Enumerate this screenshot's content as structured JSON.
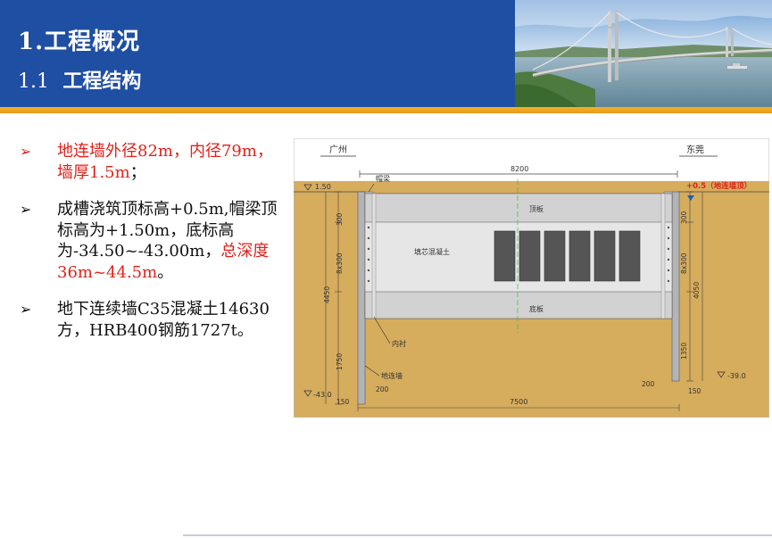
{
  "header": {
    "title_num": "1.",
    "title_text": "工程概况",
    "subtitle_num": "1.1",
    "subtitle_text": "工程结构"
  },
  "colors": {
    "header_bg": "#1f4fa3",
    "accent_bar": "#f4b02a",
    "highlight_red": "#e0221b"
  },
  "bullets": [
    {
      "icon": "arrow-bullet-icon",
      "arrow": "➢",
      "segments": [
        {
          "text": "地连墙外径82m，内径79m，墙厚1.5m",
          "color": "red"
        },
        {
          "text": "；",
          "color": "dark"
        }
      ]
    },
    {
      "icon": "arrow-bullet-icon",
      "arrow": "➢",
      "segments": [
        {
          "text": "成槽浇筑顶标高+0.5m,帽梁顶标高为+1.50m，底标高为-34.50~-43.00m，",
          "color": "dark"
        },
        {
          "text": "总深度36m~44.5m",
          "color": "red"
        },
        {
          "text": "。",
          "color": "dark"
        }
      ]
    },
    {
      "icon": "arrow-bullet-icon",
      "arrow": "➢",
      "segments": [
        {
          "text": "地下连续墙C35混凝土14630方，HRB400钢筋1727t。",
          "color": "dark"
        }
      ]
    }
  ],
  "diagram": {
    "left_label": "广州",
    "right_label": "东莞",
    "labels": {
      "cap_beam": "帽梁",
      "top_slab": "顶板",
      "core_fill": "填芯混凝土",
      "bottom_slab": "底板",
      "inner_lining": "内衬",
      "diaphragm_wall": "地连墙",
      "wall_top_note": "+0.5（地连墙顶）"
    },
    "elevations": {
      "left_top": "1.50",
      "left_bottom": "-43.0",
      "right_bottom": "-39.0"
    },
    "dims": {
      "top_width": "8200",
      "bottom_width": "7500",
      "left_300": "300",
      "left_8x300": "8x300",
      "left_4450": "4450",
      "left_1750": "1750",
      "left_200": "200",
      "left_150": "150",
      "right_300": "300",
      "right_8x300": "8x300",
      "right_4050": "4050",
      "right_1350": "1350",
      "right_200": "200",
      "right_150": "150"
    }
  },
  "photo": {
    "icon": "suspension-bridge-image"
  }
}
